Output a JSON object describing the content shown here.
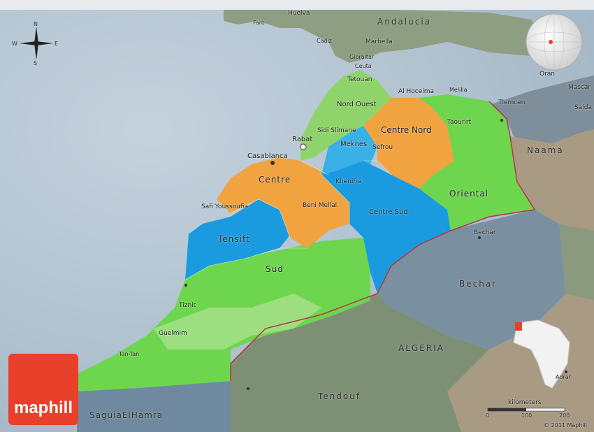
{
  "map": {
    "compass": {
      "n": "N",
      "e": "E",
      "s": "S",
      "w": "W"
    },
    "regions": [
      {
        "key": "nord-ouest",
        "label": "Nord Ouest",
        "color": "#8fd46a"
      },
      {
        "key": "centre-nord",
        "label": "Centre Nord",
        "color": "#f0a33e"
      },
      {
        "key": "oriental",
        "label": "Oriental",
        "color": "#6ed64e"
      },
      {
        "key": "centre",
        "label": "Centre",
        "color": "#f0a33e"
      },
      {
        "key": "centre-sud",
        "label": "Centre Sud",
        "color": "#1a9be0"
      },
      {
        "key": "tensift",
        "label": "Tensift",
        "color": "#1a9be0"
      },
      {
        "key": "sud",
        "label": "Sud",
        "color": "#6ed64e"
      }
    ],
    "cities": [
      {
        "key": "huelva",
        "label": "Huelva"
      },
      {
        "key": "faro",
        "label": "Faro"
      },
      {
        "key": "cadiz",
        "label": "Cadiz"
      },
      {
        "key": "marbella",
        "label": "Marbella"
      },
      {
        "key": "gibraltar",
        "label": "Gibraltar"
      },
      {
        "key": "ceuta",
        "label": "Ceuta"
      },
      {
        "key": "tetouan",
        "label": "Tetouan"
      },
      {
        "key": "al-hoceima",
        "label": "Al Hoceima"
      },
      {
        "key": "melilla",
        "label": "Melilla"
      },
      {
        "key": "oran",
        "label": "Oran"
      },
      {
        "key": "mascara",
        "label": "Mascar"
      },
      {
        "key": "saida",
        "label": "Saida"
      },
      {
        "key": "tlemcen",
        "label": "Tlemcen"
      },
      {
        "key": "taourirt",
        "label": "Taourirt"
      },
      {
        "key": "sidi-slimane",
        "label": "Sidi Slimane"
      },
      {
        "key": "rabat",
        "label": "Rabat"
      },
      {
        "key": "meknes",
        "label": "Meknes"
      },
      {
        "key": "sefrou",
        "label": "Sefrou"
      },
      {
        "key": "casablanca",
        "label": "Casablanca"
      },
      {
        "key": "khenifra",
        "label": "Khenifra"
      },
      {
        "key": "beni-mellal",
        "label": "Beni Mellal"
      },
      {
        "key": "safi-youssoufia",
        "label": "Safi Youssoufia"
      },
      {
        "key": "bechar-city",
        "label": "Bechar"
      },
      {
        "key": "tiznit",
        "label": "Tiznit"
      },
      {
        "key": "guelmim",
        "label": "Guelmim"
      },
      {
        "key": "tan-tan",
        "label": "Tan-Tan"
      },
      {
        "key": "adrar",
        "label": "Adrar"
      }
    ],
    "countries": [
      {
        "key": "andalucia",
        "label": "Andalucia"
      },
      {
        "key": "naama",
        "label": "Naama"
      },
      {
        "key": "bechar",
        "label": "Bechar"
      },
      {
        "key": "algeria",
        "label": "ALGERIA"
      },
      {
        "key": "tendouf",
        "label": "Tendouf"
      },
      {
        "key": "saguia",
        "label": "SaguiaElHamra"
      }
    ],
    "scale": {
      "title": "kilometers",
      "ticks": [
        "0",
        "100",
        "200"
      ]
    },
    "copyright": "© 2011 Maphill",
    "logo_text": "maphill",
    "colors": {
      "sea": "#aebfcc",
      "ocean_deep": "#9fb3c3",
      "spain": "#8a9a7e",
      "algeria_north": "#7f8f9c",
      "algeria_south": "#8c9a8a",
      "desert": "#a99a84",
      "tendouf": "#7d9075",
      "saguia": "#6f8aa0"
    }
  }
}
